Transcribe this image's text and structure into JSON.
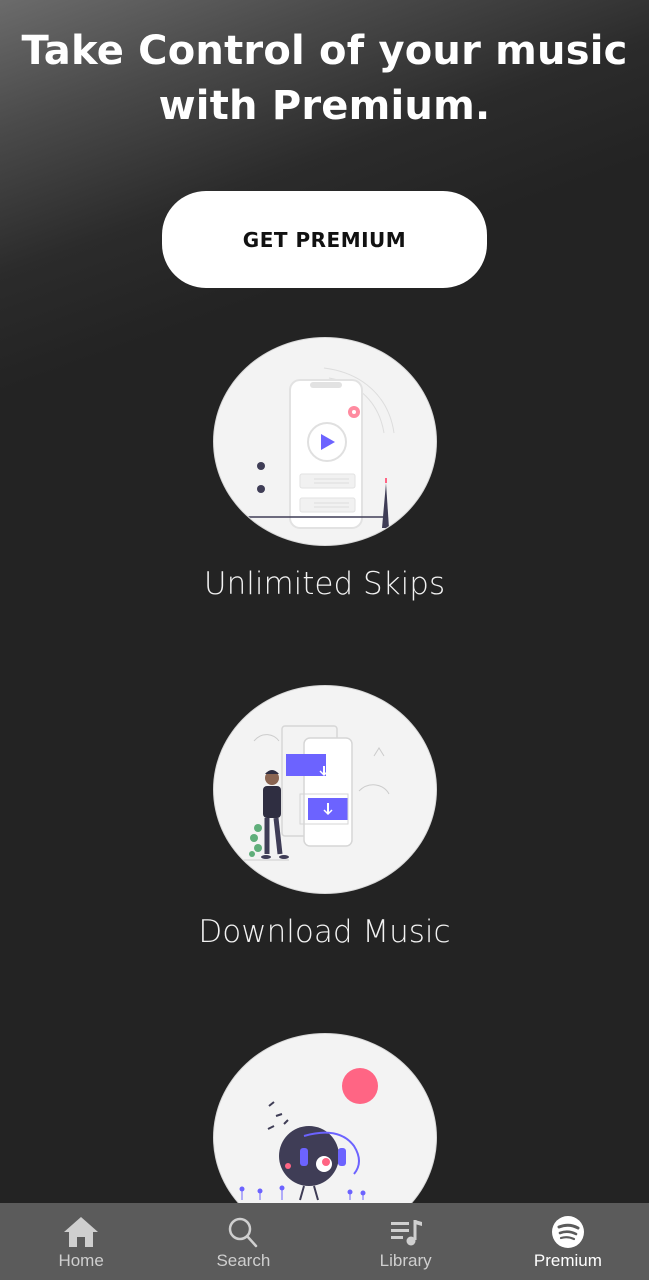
{
  "header": {
    "line1": "Take Control of your music",
    "line2": "with Premium."
  },
  "cta": {
    "label": "GET PREMIUM"
  },
  "features": [
    {
      "label": "Unlimited Skips",
      "icon": "unlimited-skips-illustration"
    },
    {
      "label": "Download Music",
      "icon": "download-music-illustration"
    },
    {
      "label": "",
      "icon": "music-listening-illustration"
    }
  ],
  "nav": {
    "items": [
      {
        "label": "Home",
        "icon": "home-icon"
      },
      {
        "label": "Search",
        "icon": "search-icon"
      },
      {
        "label": "Library",
        "icon": "library-icon"
      },
      {
        "label": "Premium",
        "icon": "spotify-icon",
        "active": true
      }
    ]
  },
  "colors": {
    "background": "#232323",
    "accent_purple": "#6c63ff",
    "accent_pink": "#ff6584",
    "nav_background": "#5b5b5b"
  }
}
